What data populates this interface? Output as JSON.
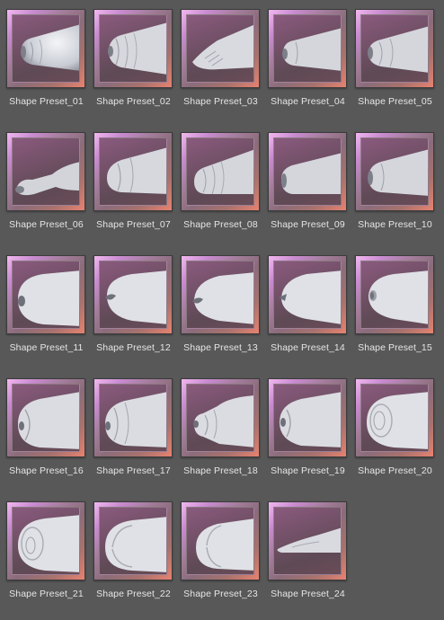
{
  "presets": [
    {
      "label": "Shape Preset_01",
      "icon": "shape-preset-thumbnail"
    },
    {
      "label": "Shape Preset_02",
      "icon": "shape-preset-thumbnail"
    },
    {
      "label": "Shape Preset_03",
      "icon": "shape-preset-thumbnail"
    },
    {
      "label": "Shape Preset_04",
      "icon": "shape-preset-thumbnail"
    },
    {
      "label": "Shape Preset_05",
      "icon": "shape-preset-thumbnail"
    },
    {
      "label": "Shape Preset_06",
      "icon": "shape-preset-thumbnail"
    },
    {
      "label": "Shape Preset_07",
      "icon": "shape-preset-thumbnail"
    },
    {
      "label": "Shape Preset_08",
      "icon": "shape-preset-thumbnail"
    },
    {
      "label": "Shape Preset_09",
      "icon": "shape-preset-thumbnail"
    },
    {
      "label": "Shape Preset_10",
      "icon": "shape-preset-thumbnail"
    },
    {
      "label": "Shape Preset_11",
      "icon": "shape-preset-thumbnail"
    },
    {
      "label": "Shape Preset_12",
      "icon": "shape-preset-thumbnail"
    },
    {
      "label": "Shape Preset_13",
      "icon": "shape-preset-thumbnail"
    },
    {
      "label": "Shape Preset_14",
      "icon": "shape-preset-thumbnail"
    },
    {
      "label": "Shape Preset_15",
      "icon": "shape-preset-thumbnail"
    },
    {
      "label": "Shape Preset_16",
      "icon": "shape-preset-thumbnail"
    },
    {
      "label": "Shape Preset_17",
      "icon": "shape-preset-thumbnail"
    },
    {
      "label": "Shape Preset_18",
      "icon": "shape-preset-thumbnail"
    },
    {
      "label": "Shape Preset_19",
      "icon": "shape-preset-thumbnail"
    },
    {
      "label": "Shape Preset_20",
      "icon": "shape-preset-thumbnail"
    },
    {
      "label": "Shape Preset_21",
      "icon": "shape-preset-thumbnail"
    },
    {
      "label": "Shape Preset_22",
      "icon": "shape-preset-thumbnail"
    },
    {
      "label": "Shape Preset_23",
      "icon": "shape-preset-thumbnail"
    },
    {
      "label": "Shape Preset_24",
      "icon": "shape-preset-thumbnail"
    }
  ],
  "colors": {
    "background": "#585858",
    "label_text": "#e6e6e6",
    "frame_top": "#f2b8f0",
    "frame_bottom": "#e88270",
    "model_surface": "#e4e6ea"
  }
}
